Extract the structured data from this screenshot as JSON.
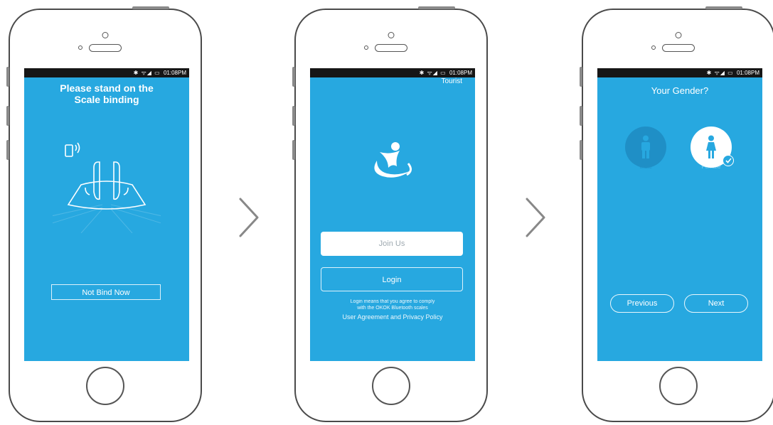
{
  "statusbar": {
    "icons": "✱ ᯤ◢ ▭",
    "time": "01:08PM"
  },
  "screen1": {
    "title_line1": "Please stand on the",
    "title_line2": "Scale binding",
    "not_bind_button": "Not Bind Now"
  },
  "screen2": {
    "tourist_link": "Tourist",
    "join_button": "Join Us",
    "login_button": "Login",
    "terms_line1": "Login means that you agree to comply",
    "terms_line2": "with the OKOK Bluetooth scales",
    "terms_links": "User Agreement and Privacy Policy"
  },
  "screen3": {
    "title": "Your Gender?",
    "male_label": "Male",
    "female_label": "Female",
    "selected": "female",
    "previous_button": "Previous",
    "next_button": "Next"
  },
  "colors": {
    "screen_bg": "#27a8e0",
    "statusbar_bg": "#161616",
    "male_circle": "#1f8fc6",
    "frame": "#4a4a4a"
  }
}
